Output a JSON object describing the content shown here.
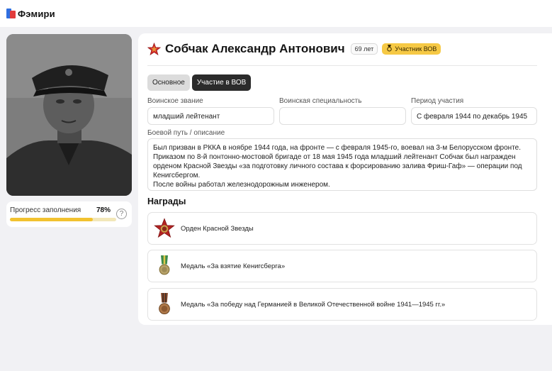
{
  "app": {
    "logo_text": "Фэмири"
  },
  "profile": {
    "name": "Собчак Александр Антонович",
    "age_badge": "69 лет",
    "participant_badge": "Участник ВОВ"
  },
  "progress": {
    "label": "Прогресс заполнения",
    "percent_text": "78%",
    "value": 0.78
  },
  "tabs": [
    {
      "label": "Основное",
      "active": false
    },
    {
      "label": "Участие в ВОВ",
      "active": true
    }
  ],
  "fields": {
    "rank": {
      "label": "Воинское звание",
      "value": "младший лейтенант"
    },
    "specialty": {
      "label": "Воинская специальность",
      "value": ""
    },
    "period": {
      "label": "Период участия",
      "value": "С февраля 1944 по декабрь 1945"
    },
    "combat_path": {
      "label": "Боевой путь / описание",
      "lines": [
        "Был призван в РККА в ноябре 1944 года, на фронте — с февраля 1945-го, воевал на 3-м Белорусском фронте.",
        "Приказом по 8-й понтонно-мостовой бригаде от 18 мая 1945 года младший лейтенант Собчак был награжден",
        "орденом Красной Звезды «за подготовку личного состава к форсированию залива Фриш-Гаф» — операции под",
        "Кенигсбергом.",
        "После войны работал железнодорожным инженером."
      ]
    }
  },
  "awards": {
    "title": "Награды",
    "items": [
      {
        "label": "Орден Красной Звезды",
        "icon": "red-star-order-icon"
      },
      {
        "label": "Медаль «За взятие Кенигсберга»",
        "icon": "green-ribbon-medal-icon"
      },
      {
        "label": "Медаль «За победу над Германией в Великой Отечественной войне 1941—1945 гг.»",
        "icon": "victory-medal-icon"
      }
    ]
  },
  "colors": {
    "accent_yellow": "#f6c945",
    "progress_fill": "#f2c230",
    "star_red": "#d42a2a",
    "tab_active": "#2b2b2b"
  }
}
